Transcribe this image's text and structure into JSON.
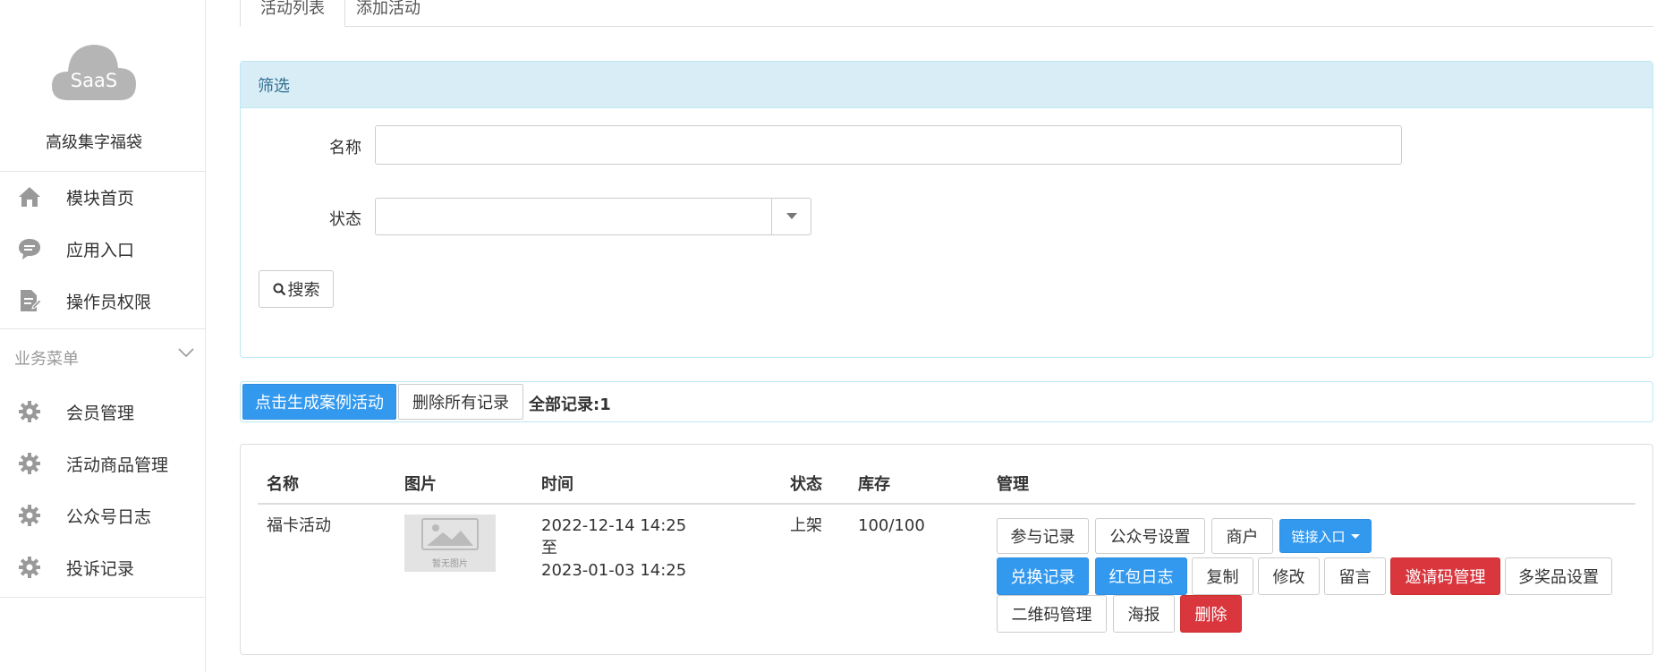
{
  "sidebar": {
    "logo_text": "SaaS",
    "module_title": "高级集字福袋",
    "top_items": [
      {
        "label": "模块首页",
        "icon": "home-icon"
      },
      {
        "label": "应用入口",
        "icon": "chat-bubble-icon"
      },
      {
        "label": "操作员权限",
        "icon": "document-edit-icon"
      }
    ],
    "group": {
      "label": "业务菜单",
      "icon": "chevron-down-icon"
    },
    "group_items": [
      {
        "label": "会员管理",
        "icon": "gear-icon"
      },
      {
        "label": "活动商品管理",
        "icon": "gear-icon"
      },
      {
        "label": "公众号日志",
        "icon": "gear-icon"
      },
      {
        "label": "投诉记录",
        "icon": "gear-icon"
      }
    ]
  },
  "tabs": [
    {
      "label": "活动列表",
      "active": true
    },
    {
      "label": "添加活动",
      "active": false
    }
  ],
  "filter": {
    "heading": "筛选",
    "name_label": "名称",
    "name_value": "",
    "status_label": "状态",
    "status_value": "",
    "search_button": "搜索"
  },
  "actions": {
    "generate_button": "点击生成案例活动",
    "delete_all_button": "删除所有记录",
    "total_label": "全部记录:1"
  },
  "table": {
    "headers": [
      "名称",
      "图片",
      "时间",
      "状态",
      "库存",
      "管理"
    ],
    "rows": [
      {
        "name": "福卡活动",
        "image_placeholder": "暂无图片",
        "time_start": "2022-12-14 14:25",
        "time_sep": "至",
        "time_end": "2023-01-03 14:25",
        "status": "上架",
        "stock": "100/100",
        "buttons_row1": [
          "参与记录",
          "公众号设置",
          "商户",
          "链接入口"
        ],
        "buttons_row2": [
          "兑换记录",
          "红包日志",
          "复制",
          "修改",
          "留言",
          "邀请码管理",
          "多奖品设置"
        ],
        "buttons_row3": [
          "二维码管理",
          "海报",
          "删除"
        ]
      }
    ]
  },
  "colors": {
    "primary": "#3399ee",
    "danger": "#d9363e",
    "panel_heading_bg": "#d9edf7",
    "panel_heading_text": "#31708f",
    "icon_gray": "#999999"
  }
}
